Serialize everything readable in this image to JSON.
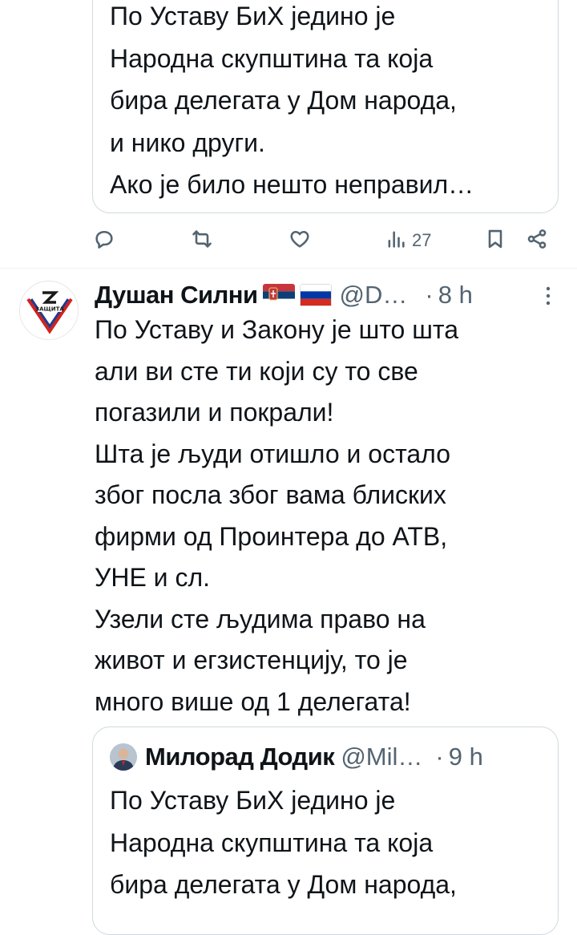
{
  "top_quote": {
    "text": "По Уставу БиХ једино је\nНародна скупштина та која\nбира делегата у Дом народа,\nи нико други.\nАко је било нешто неправил…"
  },
  "actions": {
    "reply_icon": "reply-icon",
    "retweet_icon": "retweet-icon",
    "like_icon": "like-icon",
    "views_icon": "views-icon",
    "views_count": "27",
    "bookmark_icon": "bookmark-icon",
    "share_icon": "share-icon"
  },
  "tweet": {
    "author_name": "Душан Силни",
    "flags": [
      "serbia-flag",
      "russia-flag"
    ],
    "avatar_text": "ЗАЩИТА",
    "handle": "@D…",
    "separator": "·",
    "time": "8 h",
    "text": "По Уставу и Закону је што шта\nали ви сте ти који су то све\nпогазили и покрали!\nШта је људи отишло и остало\nзбог посла због вама блиских\nфирми од Проинтера до АТВ,\nУНЕ и сл.\nУзели сте људима право на\nживот и егзистенцију, то је\nмного више од 1 делегата!"
  },
  "quoted": {
    "author_name": "Милорад Додик",
    "handle": "@Mil…",
    "separator": "·",
    "time": "9 h",
    "text": "По Уставу БиХ једино је\nНародна скупштина та која\nбира делегата у Дом народа,"
  },
  "colors": {
    "text": "#0f1419",
    "muted": "#536471",
    "border": "#cfd9de"
  }
}
